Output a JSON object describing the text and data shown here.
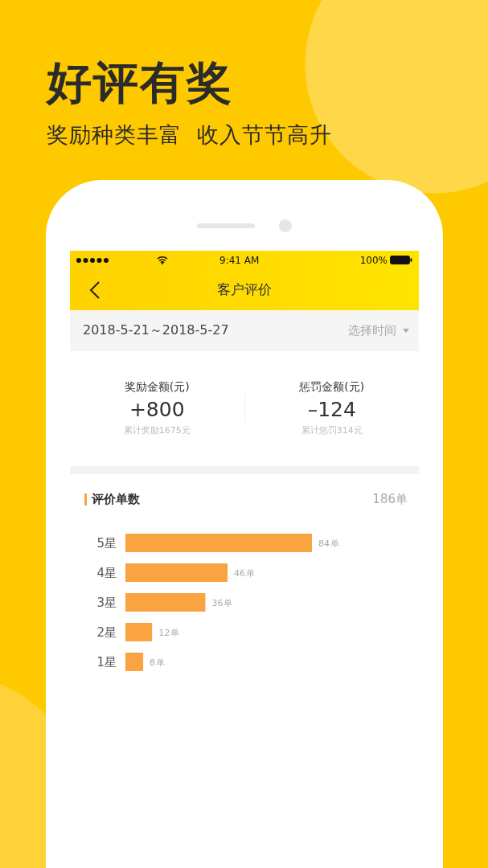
{
  "headline": "好评有奖",
  "subheadline": "奖励种类丰富  收入节节高升",
  "status_bar": {
    "time": "9:41 AM",
    "battery": "100%"
  },
  "nav": {
    "title": "客户评价"
  },
  "date_filter": {
    "range": "2018-5-21～2018-5-27",
    "picker": "选择时间"
  },
  "stats": [
    {
      "label": "奖励金额(元)",
      "value": "+800",
      "note": "累计奖励1675元"
    },
    {
      "label": "惩罚金额(元)",
      "value": "–124",
      "note": "累计惩罚314元"
    }
  ],
  "ratings": {
    "total": "186单",
    "chart_data": {
      "type": "bar",
      "orientation": "horizontal",
      "categories": [
        "5星",
        "4星",
        "3星",
        "2星",
        "1星"
      ],
      "series": [
        {
          "name": "评价单数",
          "color": "#f9a441",
          "values": [
            84,
            46,
            36,
            12,
            8
          ]
        }
      ],
      "data_labels": true,
      "annotations": [
        {
          "text": "单"
        },
        {
          "text": "单"
        },
        {
          "text": "单"
        },
        {
          "text": "单"
        },
        {
          "text": "单"
        }
      ]
    }
  }
}
